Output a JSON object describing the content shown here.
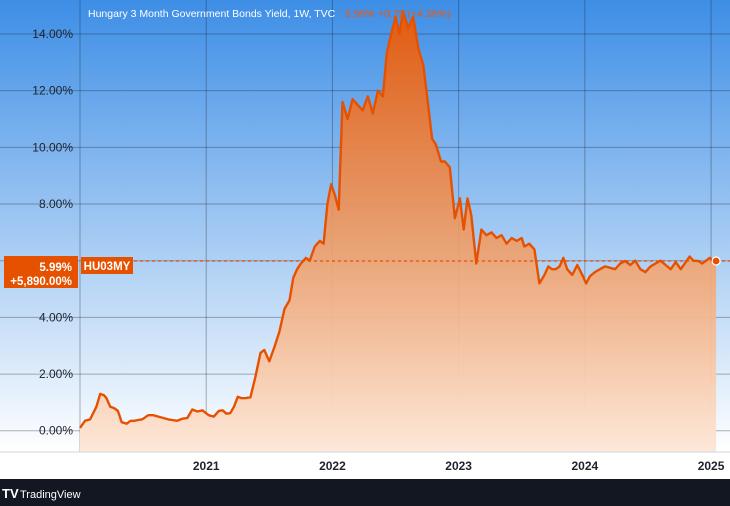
{
  "header": {
    "title": "Hungary 3 Month Government Bonds Yield, 1W, TVC",
    "price": "5.99%",
    "change": "+0.25 (+4.36%)"
  },
  "tag": {
    "value": "5.99%",
    "percent": "+5,890.00%",
    "symbol": "HU03MY"
  },
  "brand": {
    "name": "TradingView",
    "logo_text": "TV"
  },
  "colors": {
    "line": "#e65100",
    "bg_top": "#3d8ee6",
    "bg_bottom": "#ffffff",
    "area_top": "#e25b10",
    "area_bottom": "#fde8da",
    "tag_bg": "#e65100",
    "footer_bg": "#131722"
  },
  "chart_data": {
    "type": "area",
    "title": "Hungary 3 Month Government Bonds Yield, 1W, TVC",
    "xlabel": "",
    "ylabel": "",
    "ylim": [
      -0.75,
      15.2
    ],
    "xlim": [
      2020.0,
      2025.15
    ],
    "y_ticks": [
      0,
      2,
      4,
      6,
      8,
      10,
      12,
      14
    ],
    "y_tick_labels": [
      "0.00%",
      "2.00%",
      "4.00%",
      "6.00%",
      "8.00%",
      "10.00%",
      "12.00%",
      "14.00%"
    ],
    "x_ticks": [
      2021,
      2022,
      2023,
      2024,
      2025
    ],
    "x_tick_labels": [
      "2021",
      "2022",
      "2023",
      "2024",
      "2025"
    ],
    "grid": true,
    "reference_line": 5.99,
    "series": [
      {
        "x": [
          2020.0,
          2020.04,
          2020.08,
          2020.13,
          2020.16,
          2020.19,
          2020.21,
          2020.24,
          2020.27,
          2020.3,
          2020.33,
          2020.37,
          2020.4,
          2020.43,
          2020.46,
          2020.49,
          2020.5,
          2020.54,
          2020.58,
          2020.62,
          2020.7,
          2020.73,
          2020.77,
          2020.81,
          2020.85,
          2020.89,
          2020.93,
          2020.97,
          2021.02,
          2021.06,
          2021.1,
          2021.13,
          2021.16,
          2021.19,
          2021.22,
          2021.25,
          2021.28,
          2021.31,
          2021.35,
          2021.39,
          2021.43,
          2021.46,
          2021.5,
          2021.54,
          2021.58,
          2021.62,
          2021.66,
          2021.69,
          2021.72,
          2021.75,
          2021.79,
          2021.82,
          2021.86,
          2021.9,
          2021.93,
          2021.96,
          2021.99,
          2022.02,
          2022.05,
          2022.08,
          2022.12,
          2022.16,
          2022.2,
          2022.24,
          2022.28,
          2022.32,
          2022.36,
          2022.4,
          2022.43,
          2022.46,
          2022.5,
          2022.53,
          2022.56,
          2022.6,
          2022.64,
          2022.68,
          2022.72,
          2022.75,
          2022.79,
          2022.82,
          2022.86,
          2022.89,
          2022.93,
          2022.97,
          2023.01,
          2023.04,
          2023.07,
          2023.1,
          2023.14,
          2023.18,
          2023.22,
          2023.26,
          2023.3,
          2023.34,
          2023.38,
          2023.42,
          2023.46,
          2023.5,
          2023.52,
          2023.56,
          2023.6,
          2023.64,
          2023.68,
          2023.71,
          2023.74,
          2023.77,
          2023.8,
          2023.83,
          2023.86,
          2023.9,
          2023.94,
          2023.98,
          2024.01,
          2024.04,
          2024.08,
          2024.12,
          2024.16,
          2024.2,
          2024.24,
          2024.28,
          2024.32,
          2024.36,
          2024.4,
          2024.44,
          2024.48,
          2024.52,
          2024.56,
          2024.6,
          2024.64,
          2024.68,
          2024.72,
          2024.76,
          2024.8,
          2024.83,
          2024.86,
          2024.9,
          2024.93,
          2024.96,
          2024.99,
          2025.02,
          2025.04
        ],
        "y": [
          0.1,
          0.35,
          0.4,
          0.85,
          1.3,
          1.25,
          1.15,
          0.85,
          0.8,
          0.7,
          0.3,
          0.25,
          0.35,
          0.35,
          0.38,
          0.4,
          0.42,
          0.55,
          0.55,
          0.5,
          0.4,
          0.38,
          0.35,
          0.42,
          0.45,
          0.75,
          0.68,
          0.72,
          0.55,
          0.5,
          0.7,
          0.72,
          0.6,
          0.62,
          0.85,
          1.2,
          1.15,
          1.15,
          1.18,
          1.9,
          2.75,
          2.85,
          2.45,
          2.95,
          3.5,
          4.3,
          4.6,
          5.4,
          5.7,
          5.9,
          6.1,
          6.0,
          6.5,
          6.7,
          6.6,
          8.0,
          8.7,
          8.3,
          7.8,
          11.6,
          11.0,
          11.7,
          11.5,
          11.3,
          11.8,
          11.2,
          12.0,
          11.8,
          13.3,
          13.9,
          14.6,
          14.0,
          14.8,
          14.2,
          14.6,
          13.5,
          12.9,
          11.8,
          10.3,
          10.1,
          9.5,
          9.5,
          9.3,
          7.5,
          8.2,
          7.1,
          8.2,
          7.6,
          5.9,
          7.1,
          6.9,
          7.0,
          6.8,
          6.9,
          6.6,
          6.8,
          6.7,
          6.8,
          6.5,
          6.6,
          6.4,
          5.2,
          5.5,
          5.8,
          5.7,
          5.7,
          5.8,
          6.1,
          5.7,
          5.5,
          5.85,
          5.5,
          5.2,
          5.45,
          5.6,
          5.7,
          5.8,
          5.75,
          5.7,
          5.9,
          5.99,
          5.85,
          6.0,
          5.7,
          5.6,
          5.8,
          5.9,
          6.0,
          5.85,
          5.7,
          5.95,
          5.7,
          5.95,
          6.15,
          6.0,
          5.99,
          5.9,
          6.0,
          6.1,
          5.99,
          5.99
        ],
        "name": "HU03MY"
      }
    ]
  }
}
